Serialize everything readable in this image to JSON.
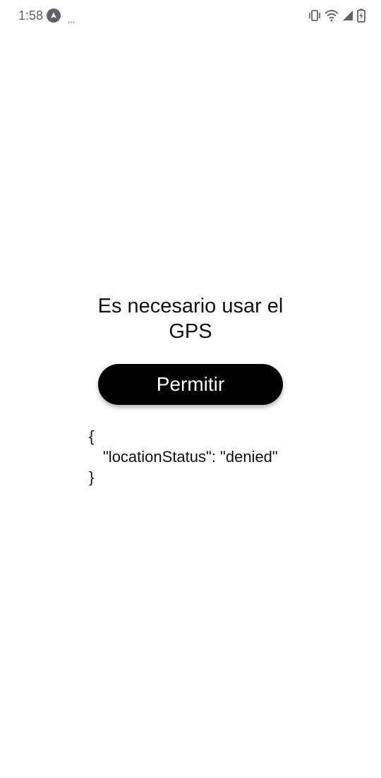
{
  "status_bar": {
    "time": "1:58",
    "app_icon": "navigation-arrow-icon",
    "overflow_indicator": "more-dots-icon",
    "icons": [
      "vibrate-icon",
      "wifi-icon",
      "cellular-signal-icon",
      "battery-charging-icon"
    ],
    "icon_color": "#5f6368"
  },
  "main": {
    "message": "Es necesario usar el GPS",
    "button_label": "Permitir",
    "button_color": "#000000",
    "button_text_color": "#ffffff",
    "json_open": "{",
    "json_line": "\"locationStatus\": \"denied\"",
    "json_close": "}"
  }
}
